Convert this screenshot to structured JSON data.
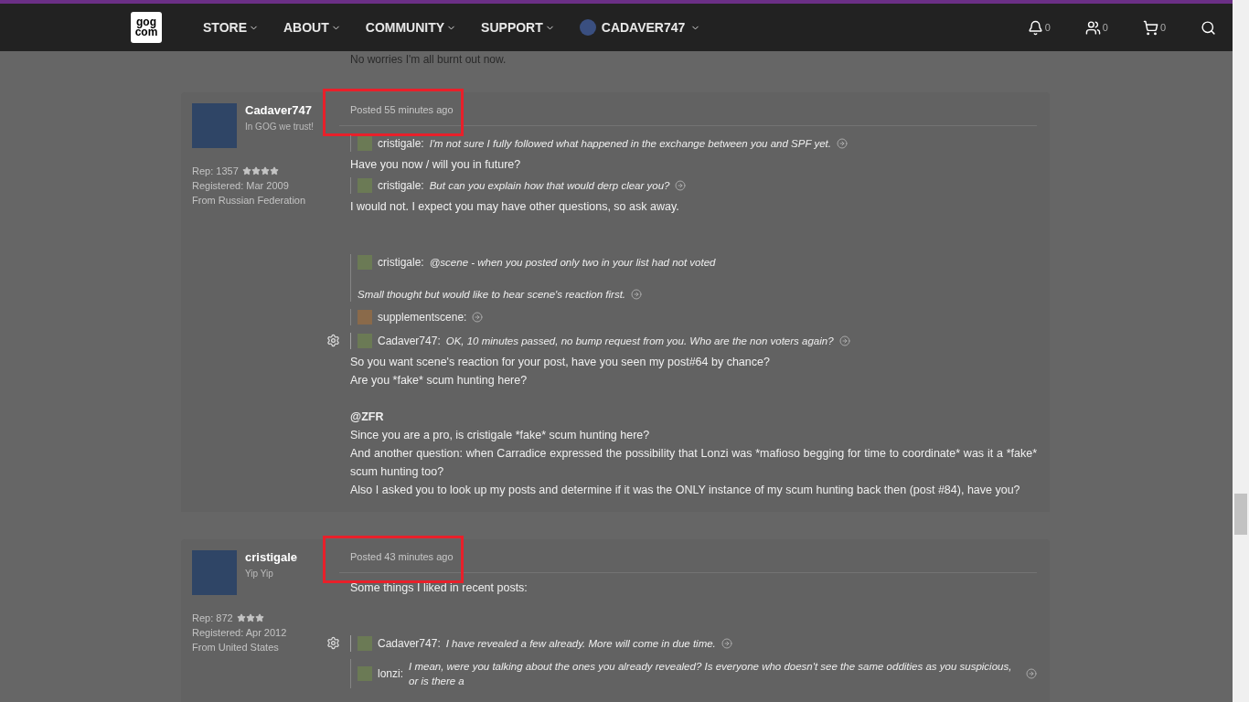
{
  "nav": {
    "logo": [
      "gog",
      "com"
    ],
    "menu": [
      {
        "label": "STORE"
      },
      {
        "label": "ABOUT"
      },
      {
        "label": "COMMUNITY"
      },
      {
        "label": "SUPPORT"
      }
    ],
    "user": {
      "name": "CADAVER747"
    },
    "counters": [
      {
        "kind": "notifications",
        "count": "0"
      },
      {
        "kind": "friends",
        "count": "0"
      },
      {
        "kind": "cart",
        "count": "0"
      }
    ]
  },
  "previous_post_tail": "No worries I'm all burnt out now.",
  "posts": [
    {
      "author": "Cadaver747",
      "tagline": "In GOG we trust!",
      "rep": "Rep: 1357",
      "stars": 4,
      "registered": "Registered: Mar 2009",
      "location": "From Russian Federation",
      "posted": "Posted 55 minutes ago",
      "highlighted": true,
      "content": [
        {
          "kind": "quote",
          "author": "cristigale:",
          "lines": [
            "I'm not sure I fully followed what happened in the exchange between you and SPF yet."
          ],
          "gear": false
        },
        {
          "kind": "paragraph",
          "text": "Have you now / will you in future?",
          "bold": false
        },
        {
          "kind": "quote",
          "author": "cristigale:",
          "lines": [
            "But can you explain how that would derp clear you?"
          ],
          "gear": false
        },
        {
          "kind": "paragraph",
          "text": "I would not. I expect you may have other questions, so ask away.",
          "bold": false
        },
        {
          "kind": "spacer"
        },
        {
          "kind": "quote",
          "author": "cristigale:",
          "lines": [
            "@scene - when you posted only two in your list had not voted",
            "Small thought but would like to hear scene's reaction first."
          ],
          "gear": false
        },
        {
          "kind": "quote",
          "author": "supplementscene:",
          "gear": false
        },
        {
          "kind": "quote",
          "author": "Cadaver747:",
          "lines": [
            "OK, 10 minutes passed, no bump request from you. Who are the non voters again?"
          ],
          "gear": true
        },
        {
          "kind": "paragraph",
          "text": "So you want scene's reaction for your post, have you seen my post#64 by chance?",
          "bold": false
        },
        {
          "kind": "paragraph",
          "text": "Are you *fake* scum hunting here?",
          "bold": false
        },
        {
          "kind": "blank"
        },
        {
          "kind": "paragraph",
          "text": "@ZFR",
          "bold": true
        },
        {
          "kind": "paragraph",
          "text": "Since you are a pro, is cristigale *fake* scum hunting here?",
          "bold": false
        },
        {
          "kind": "paragraph",
          "text": "And another question: when Carradice expressed the possibility that Lonzi was *mafioso begging for time to coordinate* was it a *fake* scum hunting too?",
          "bold": false
        },
        {
          "kind": "paragraph",
          "text": "Also I asked you to look up my posts and determine if it was the ONLY instance of my scum hunting back then (post #84), have you?",
          "bold": false
        }
      ]
    },
    {
      "author": "cristigale",
      "tagline": "Yip Yip",
      "rep": "Rep: 872",
      "stars": 3,
      "registered": "Registered: Apr 2012",
      "location": "From United States",
      "posted": "Posted 43 minutes ago",
      "highlighted": true,
      "content": [
        {
          "kind": "paragraph",
          "text": "Some things I liked in recent posts:",
          "bold": false
        },
        {
          "kind": "spacer"
        },
        {
          "kind": "quote",
          "author": "Cadaver747:",
          "lines": [
            "I have revealed a few already. More will come in due time."
          ],
          "gear": true
        },
        {
          "kind": "quote",
          "author": "lonzi:",
          "lines": [
            "I mean, were you talking about the ones you already revealed? Is everyone who doesn't see the same oddities as you suspicious, or is there a"
          ],
          "gear": false
        }
      ]
    }
  ]
}
